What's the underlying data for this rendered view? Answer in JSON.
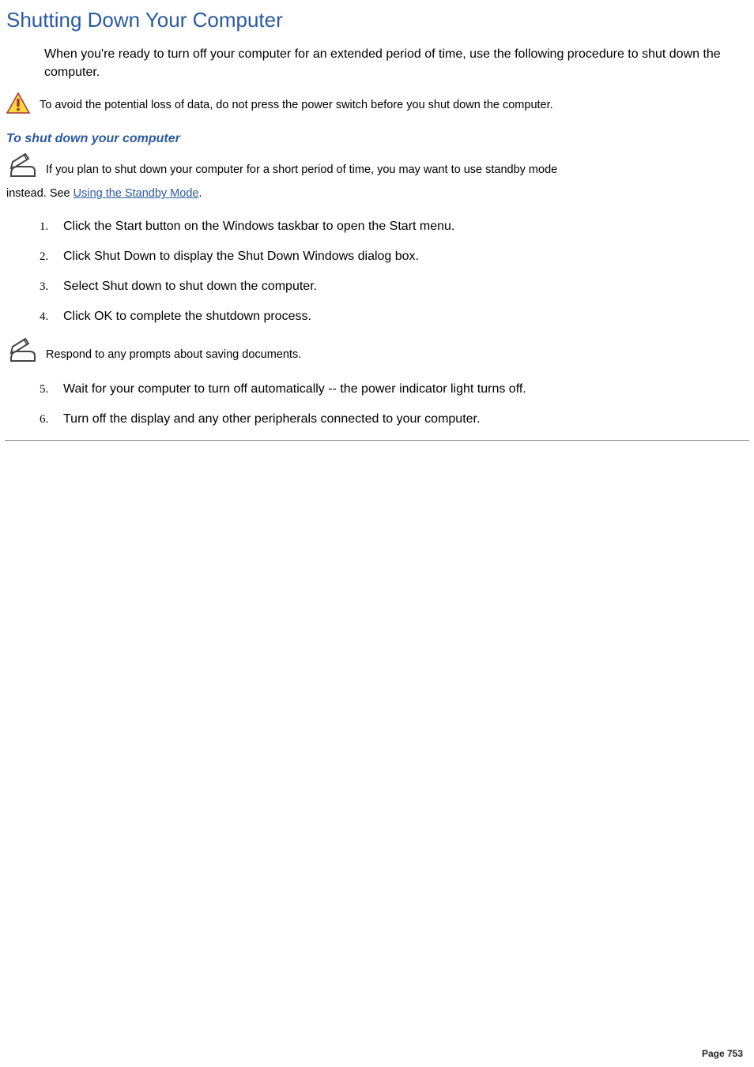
{
  "title": "Shutting Down Your Computer",
  "intro": "When you're ready to turn off your computer for an extended period of time, use the following procedure to shut down the computer.",
  "warning": "To avoid the potential loss of data, do not press the power switch before you shut down the computer.",
  "subtitle": "To shut down your computer",
  "note1_pre": "If you plan to shut down your computer for a short period of time, you may want to use standby mode instead. See ",
  "note1_link": "Using the Standby Mode",
  "note1_post": ".",
  "steps": [
    "Click the Start button on the Windows taskbar to open the Start menu.",
    "Click Shut Down to display the Shut Down Windows dialog box.",
    "Select Shut down to shut down the computer.",
    "Click OK to complete the shutdown process."
  ],
  "note2": "Respond to any prompts about saving documents.",
  "steps2": [
    "Wait for your computer to turn off automatically -- the power indicator light turns off.",
    "Turn off the display and any other peripherals connected to your computer."
  ],
  "page_label": "Page 753"
}
